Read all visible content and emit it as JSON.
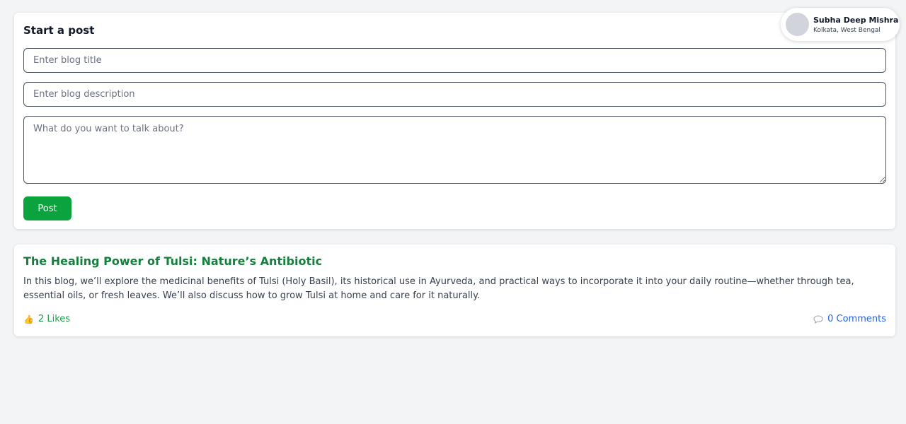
{
  "profile": {
    "name": "Subha Deep Mishra",
    "location": "Kolkata, West Bengal"
  },
  "composer": {
    "heading": "Start a post",
    "title_placeholder": "Enter blog title",
    "description_placeholder": "Enter blog description",
    "body_placeholder": "What do you want to talk about?",
    "post_label": "Post"
  },
  "posts": [
    {
      "title": "The Healing Power of Tulsi: Nature’s Antibiotic",
      "description": "In this blog, we’ll explore the medicinal benefits of Tulsi (Holy Basil), its historical use in Ayurveda, and practical ways to incorporate it into your daily routine—whether through tea, essential oils, or fresh leaves. We’ll also discuss how to grow Tulsi at home and care for it naturally.",
      "likes_label": "2 Likes",
      "comments_label": "0 Comments"
    }
  ],
  "icons": {
    "like": "thumbs-up-icon",
    "comment": "comment-icon"
  },
  "colors": {
    "accent_green": "#0aa33d",
    "title_green": "#15803d",
    "link_blue": "#2563eb",
    "background": "#f3f4f6"
  }
}
